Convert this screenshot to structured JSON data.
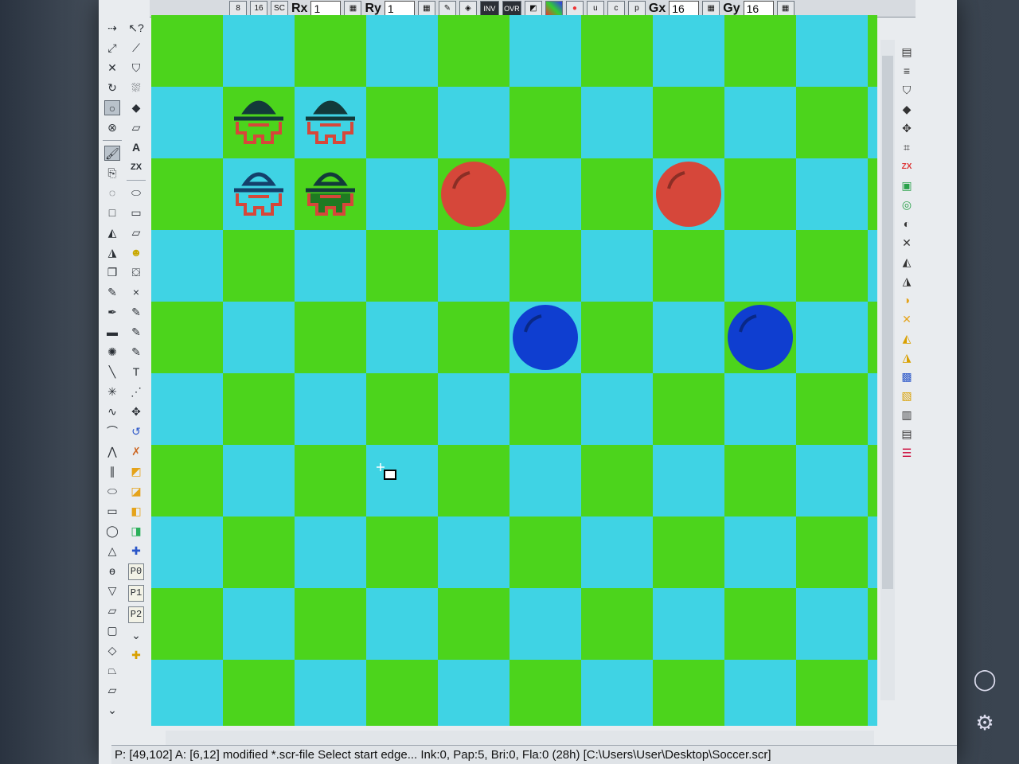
{
  "toolbar": {
    "rx_label": "Rx",
    "rx_value": "1",
    "ry_label": "Ry",
    "ry_value": "1",
    "inv_label": "INV",
    "ovr_label": "OVR",
    "gx_label": "Gx",
    "gx_value": "16",
    "gy_label": "Gy",
    "gy_value": "16",
    "small_buttons": [
      "8",
      "16",
      "SC"
    ]
  },
  "left_tools_b": {
    "text_tool": "A",
    "zx_tool": "ZX",
    "p0": "P0",
    "p1": "P1",
    "p2": "P2"
  },
  "right_panel": {
    "zx_label": "ZX"
  },
  "board": {
    "colors": {
      "green": "#4cd41c",
      "cyan": "#3fd3e4",
      "red": "#d6473a",
      "blue": "#0f3ed0",
      "dark": "#123a3a"
    },
    "sprites": [
      {
        "kind": "player-red-dark",
        "cell": [
          1,
          1
        ]
      },
      {
        "kind": "player-red-dark-side",
        "cell": [
          2,
          1
        ]
      },
      {
        "kind": "player-red-blue",
        "cell": [
          1,
          2
        ]
      },
      {
        "kind": "player-red-green",
        "cell": [
          2,
          2
        ]
      },
      {
        "kind": "ball-red",
        "cell": [
          4,
          2
        ]
      },
      {
        "kind": "ball-red",
        "cell": [
          7,
          2
        ]
      },
      {
        "kind": "ball-blue",
        "cell": [
          5,
          4
        ]
      },
      {
        "kind": "ball-blue",
        "cell": [
          8,
          4
        ]
      }
    ]
  },
  "status": {
    "text": "P: [49,102] A: [6,12] modified *.scr-file Select start edge... Ink:0, Pap:5, Bri:0, Fla:0 (28h) [C:\\Users\\User\\Desktop\\Soccer.scr]"
  }
}
